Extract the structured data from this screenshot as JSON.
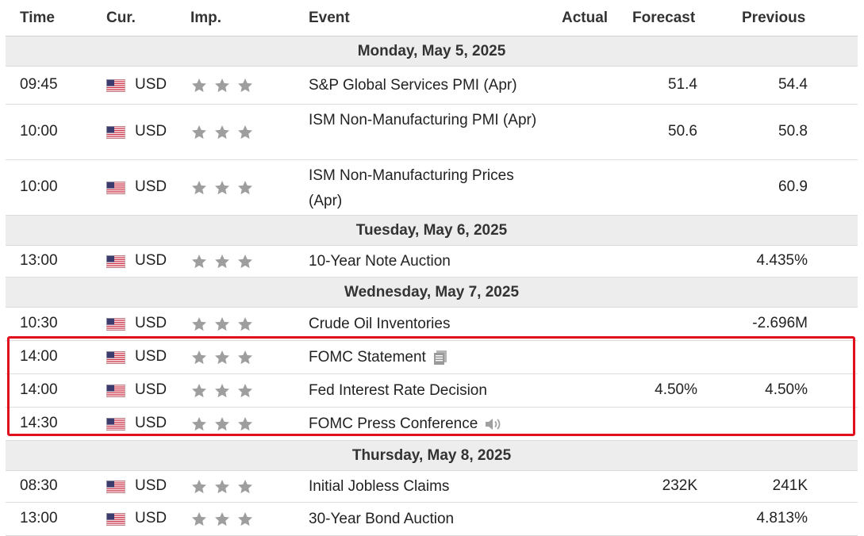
{
  "headers": {
    "time": "Time",
    "currency": "Cur.",
    "importance": "Imp.",
    "event": "Event",
    "actual": "Actual",
    "forecast": "Forecast",
    "previous": "Previous"
  },
  "colors": {
    "highlight": "#e0101f",
    "star": "#9e9e9e",
    "day_bg": "#ededed"
  },
  "days": [
    {
      "label": "Monday, May 5, 2025"
    },
    {
      "label": "Tuesday, May 6, 2025"
    },
    {
      "label": "Wednesday, May 7, 2025"
    },
    {
      "label": "Thursday, May 8, 2025"
    }
  ],
  "rows": [
    {
      "time": "09:45",
      "currency": "USD",
      "stars": 3,
      "event": "S&P Global Services PMI (Apr)",
      "actual": "",
      "forecast": "51.4",
      "previous": "54.4"
    },
    {
      "time": "10:00",
      "currency": "USD",
      "stars": 3,
      "event": "ISM Non-Manufacturing PMI (Apr)",
      "actual": "",
      "forecast": "50.6",
      "previous": "50.8"
    },
    {
      "time": "10:00",
      "currency": "USD",
      "stars": 3,
      "event": "ISM Non-Manufacturing Prices (Apr)",
      "actual": "",
      "forecast": "",
      "previous": "60.9"
    },
    {
      "time": "13:00",
      "currency": "USD",
      "stars": 3,
      "event": "10-Year Note Auction",
      "actual": "",
      "forecast": "",
      "previous": "4.435%"
    },
    {
      "time": "10:30",
      "currency": "USD",
      "stars": 3,
      "event": "Crude Oil Inventories",
      "actual": "",
      "forecast": "",
      "previous": "-2.696M"
    },
    {
      "time": "14:00",
      "currency": "USD",
      "stars": 3,
      "event": "FOMC Statement",
      "actual": "",
      "forecast": "",
      "previous": "",
      "icon": "document-icon"
    },
    {
      "time": "14:00",
      "currency": "USD",
      "stars": 3,
      "event": "Fed Interest Rate Decision",
      "actual": "",
      "forecast": "4.50%",
      "previous": "4.50%"
    },
    {
      "time": "14:30",
      "currency": "USD",
      "stars": 3,
      "event": "FOMC Press Conference",
      "actual": "",
      "forecast": "",
      "previous": "",
      "icon": "speaker-icon"
    },
    {
      "time": "08:30",
      "currency": "USD",
      "stars": 3,
      "event": "Initial Jobless Claims",
      "actual": "",
      "forecast": "232K",
      "previous": "241K"
    },
    {
      "time": "13:00",
      "currency": "USD",
      "stars": 3,
      "event": "30-Year Bond Auction",
      "actual": "",
      "forecast": "",
      "previous": "4.813%"
    }
  ]
}
